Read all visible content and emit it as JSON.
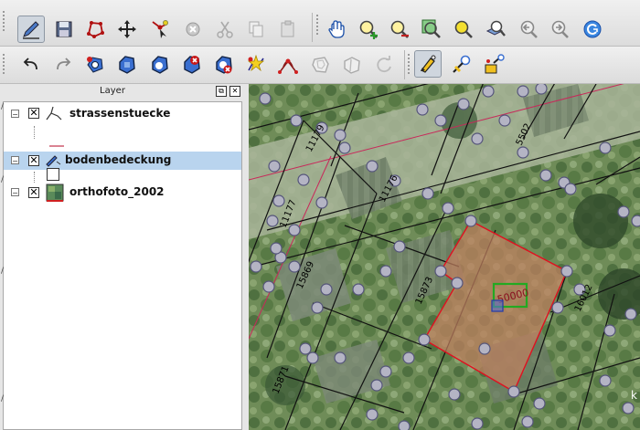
{
  "layer_panel": {
    "title": "Layer",
    "float_button": "⧉",
    "close_button": "✕",
    "layers": [
      {
        "name": "strassenstuecke",
        "checked": "✕",
        "expanded": "−",
        "selected": false
      },
      {
        "name": "bodenbedeckung",
        "checked": "✕",
        "expanded": "−",
        "selected": true
      },
      {
        "name": "orthofoto_2002",
        "checked": "✕",
        "expanded": "−",
        "selected": false
      }
    ]
  },
  "map": {
    "selected_feature_label": "50000",
    "parcel_labels": [
      "11179",
      "5502",
      "11177",
      "11176",
      "15869",
      "15873",
      "16012",
      "15871"
    ],
    "colors": {
      "selection_fill": "#c08060",
      "selection_outline": "#e01020",
      "label_box": "#22aa22",
      "vertex": "#b4b4c4"
    }
  },
  "toolbar_icons": {
    "row1": [
      "edit-pencil-icon",
      "save-icon",
      "digitize-polygon-icon",
      "move-feature-icon",
      "node-tool-icon",
      "delete-icon",
      "cut-icon",
      "copy-icon",
      "paste-icon",
      "pan-hand-icon",
      "zoom-in-icon",
      "zoom-out-icon",
      "zoom-full-icon",
      "zoom-selection-icon",
      "zoom-layer-icon",
      "zoom-last-icon",
      "zoom-next-icon",
      "refresh-icon"
    ],
    "row2": [
      "undo-icon",
      "redo-icon",
      "add-ring-icon",
      "add-part-icon",
      "fill-ring-icon",
      "delete-ring-icon",
      "delete-part-icon",
      "reshape-icon",
      "offset-curve-icon",
      "simplify-icon",
      "split-icon",
      "merge-icon",
      "rotate-icon",
      "node-edit-icon",
      "label-icon",
      "pin-label-icon"
    ]
  },
  "left_strip_marks": [
    "/",
    "/",
    "/",
    "/"
  ]
}
